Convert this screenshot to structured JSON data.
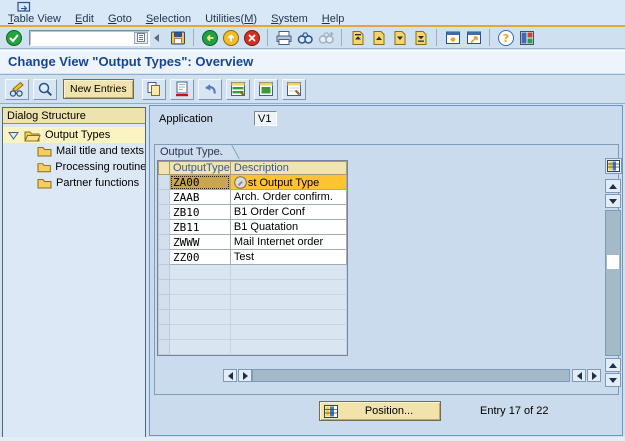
{
  "titlebar": {
    "title": "Change View \"Output Types\": Overview"
  },
  "menu": {
    "items": [
      {
        "label": "Table View",
        "mnemonic": "T"
      },
      {
        "label": "Edit",
        "mnemonic": "E"
      },
      {
        "label": "Goto",
        "mnemonic": "G"
      },
      {
        "label": "Selection",
        "mnemonic": "S"
      },
      {
        "label": "Utilities(M)",
        "mnemonic": "M"
      },
      {
        "label": "System",
        "mnemonic": "S"
      },
      {
        "label": "Help",
        "mnemonic": "H"
      }
    ]
  },
  "toolbar": {
    "command_value": "",
    "icons": [
      "enter-icon",
      "command-history-icon",
      "collapse-icon",
      "save-icon",
      "back-icon",
      "exit-icon",
      "cancel-icon",
      "print-icon",
      "find-icon",
      "find-next-icon",
      "first-page-icon",
      "page-up-icon",
      "page-down-icon",
      "last-page-icon",
      "new-session-icon",
      "create-shortcut-icon",
      "help-icon",
      "customize-layout-icon"
    ]
  },
  "app_toolbar": {
    "new_entries_label": "New Entries",
    "icons": [
      "change-display-icon",
      "display-view-icon",
      "copy-as-icon",
      "delete-icon",
      "undo-icon",
      "select-all-icon",
      "select-block-icon",
      "deselect-all-icon"
    ]
  },
  "sidebar": {
    "header": "Dialog Structure",
    "tree": {
      "root": "Output Types",
      "children": [
        "Mail title and texts",
        "Processing routine:",
        "Partner functions"
      ]
    }
  },
  "content": {
    "application_label": "Application",
    "application_value": "V1",
    "group_tab": "Output Types",
    "table": {
      "columns": [
        "OutputType",
        "Description"
      ],
      "rows": [
        {
          "type": "ZA00",
          "description": "st Output Type",
          "selected": true,
          "icon": "cell-display-icon"
        },
        {
          "type": "ZAAB",
          "description": "Arch. Order confirm."
        },
        {
          "type": "ZB10",
          "description": "B1 Order Conf"
        },
        {
          "type": "ZB11",
          "description": "B1 Quatation"
        },
        {
          "type": "ZWWW",
          "description": "Mail Internet order"
        },
        {
          "type": "ZZ00",
          "description": "Test"
        }
      ],
      "empty_row_count": 6
    },
    "footer": {
      "position_label": "Position...",
      "entry_status": "Entry 17 of 22"
    }
  },
  "colors": {
    "accent_orange_line": "#eda13c",
    "title_blue": "#17458f",
    "selected_row": "#fcc430",
    "selected_cell": "#c8a551",
    "table_header_bg": "#f2e4b2",
    "button_tan": "#f1e3ab",
    "tree_highlight": "#fbf3c2"
  }
}
